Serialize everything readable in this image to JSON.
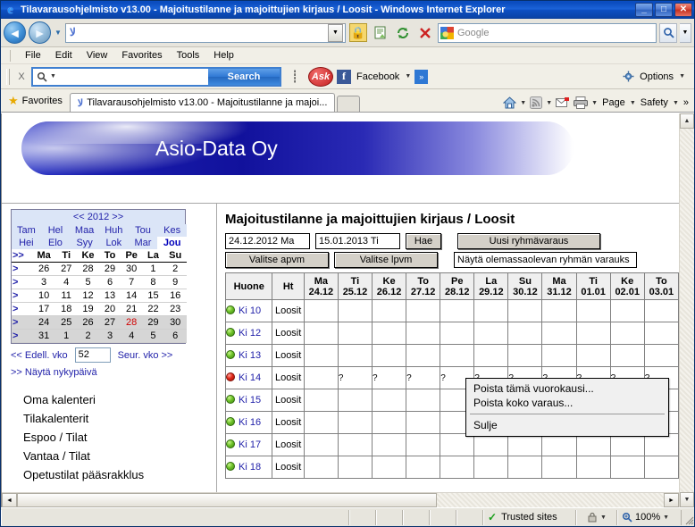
{
  "window": {
    "title": "Tilavarausohjelmisto v13.00 - Majoitustilanne ja majoittujien kirjaus / Loosit - Windows Internet Explorer",
    "minimize": "_",
    "maximize": "□",
    "close": "✕"
  },
  "addressbar": {
    "url": "",
    "back_icon": "◄",
    "forward_icon": "►",
    "dropdown_icon": "▼",
    "google_placeholder": "Google"
  },
  "menubar": {
    "items": [
      "File",
      "Edit",
      "View",
      "Favorites",
      "Tools",
      "Help"
    ]
  },
  "asktoolbar": {
    "close_label": "X",
    "search_value": "",
    "search_button": "Search",
    "ask_logo": "Ask",
    "facebook_label": "Facebook",
    "more_chevron": "»",
    "options_label": "Options"
  },
  "tabbar": {
    "favorites_label": "Favorites",
    "tab_title": "Tilavarausohjelmisto v13.00 - Majoitustilanne ja majoi...",
    "page_label": "Page",
    "safety_label": "Safety",
    "overflow": "»"
  },
  "banner": {
    "company": "Asio-Data Oy"
  },
  "calendar": {
    "year_nav": "<< 2012 >>",
    "months_row1": [
      "Tam",
      "Hel",
      "Maa",
      "Huh",
      "Tou",
      "Kes"
    ],
    "months_row2": [
      "Hei",
      "Elo",
      "Syy",
      "Lok",
      "Mar",
      "Jou"
    ],
    "current_month": "Jou",
    "header_arrow": ">>",
    "weekdays": [
      "Ma",
      "Ti",
      "Ke",
      "To",
      "Pe",
      "La",
      "Su"
    ],
    "row_arrow": ">",
    "weeks": [
      {
        "days": [
          "26",
          "27",
          "28",
          "29",
          "30",
          "1",
          "2"
        ],
        "selected": false
      },
      {
        "days": [
          "3",
          "4",
          "5",
          "6",
          "7",
          "8",
          "9"
        ],
        "selected": false
      },
      {
        "days": [
          "10",
          "11",
          "12",
          "13",
          "14",
          "15",
          "16"
        ],
        "selected": false
      },
      {
        "days": [
          "17",
          "18",
          "19",
          "20",
          "21",
          "22",
          "23"
        ],
        "selected": false
      },
      {
        "days": [
          "24",
          "25",
          "26",
          "27",
          "28",
          "29",
          "30"
        ],
        "selected": true,
        "today_index": 4
      },
      {
        "days": [
          "31",
          "1",
          "2",
          "3",
          "4",
          "5",
          "6"
        ],
        "selected": true
      }
    ],
    "prev_week": "<< Edell. vko",
    "week_number": "52",
    "next_week": "Seur. vko >>",
    "today_link": ">> Näytä nykypäivä"
  },
  "sidebar": {
    "items": [
      {
        "label": "Oma kalenteri"
      },
      {
        "label": "Tilakalenterit"
      },
      {
        "label": "Espoo / Tilat"
      },
      {
        "label": "Vantaa / Tilat"
      },
      {
        "label": "Opetustilat pääsrakklus"
      }
    ]
  },
  "main": {
    "page_title": "Majoitustilanne ja majoittujien kirjaus / Loosit",
    "start_date": "24.12.2012 Ma",
    "end_date": "15.01.2013 Ti",
    "search_button": "Hae",
    "new_group_button": "Uusi ryhmävaraus",
    "pick_start_button": "Valitse apvm",
    "pick_end_button": "Valitse lpvm",
    "group_field": "Näytä olemassaolevan ryhmän varauks"
  },
  "booking_table": {
    "col_room": "Huone",
    "col_type": "Ht",
    "day_columns": [
      {
        "dow": "Ma",
        "date": "24.12"
      },
      {
        "dow": "Ti",
        "date": "25.12"
      },
      {
        "dow": "Ke",
        "date": "26.12"
      },
      {
        "dow": "To",
        "date": "27.12"
      },
      {
        "dow": "Pe",
        "date": "28.12"
      },
      {
        "dow": "La",
        "date": "29.12"
      },
      {
        "dow": "Su",
        "date": "30.12"
      },
      {
        "dow": "Ma",
        "date": "31.12"
      },
      {
        "dow": "Ti",
        "date": "01.01"
      },
      {
        "dow": "Ke",
        "date": "02.01"
      },
      {
        "dow": "To",
        "date": "03.01"
      }
    ],
    "booked_marker": "?",
    "rows": [
      {
        "room": "Ki 10",
        "type": "Loosit",
        "status": "free",
        "cells": [
          0,
          0,
          0,
          0,
          0,
          0,
          0,
          0,
          0,
          0,
          0
        ]
      },
      {
        "room": "Ki 12",
        "type": "Loosit",
        "status": "free",
        "cells": [
          0,
          0,
          0,
          0,
          0,
          0,
          0,
          0,
          0,
          0,
          0
        ]
      },
      {
        "room": "Ki 13",
        "type": "Loosit",
        "status": "free",
        "cells": [
          0,
          0,
          0,
          0,
          0,
          0,
          0,
          0,
          0,
          0,
          0
        ]
      },
      {
        "room": "Ki 14",
        "type": "Loosit",
        "status": "occupied",
        "cells": [
          0,
          1,
          1,
          1,
          1,
          1,
          1,
          1,
          1,
          1,
          1
        ]
      },
      {
        "room": "Ki 15",
        "type": "Loosit",
        "status": "free",
        "cells": [
          0,
          0,
          0,
          0,
          0,
          0,
          0,
          0,
          0,
          0,
          0
        ]
      },
      {
        "room": "Ki 16",
        "type": "Loosit",
        "status": "free",
        "cells": [
          0,
          0,
          0,
          0,
          0,
          0,
          0,
          0,
          0,
          0,
          0
        ]
      },
      {
        "room": "Ki 17",
        "type": "Loosit",
        "status": "free",
        "cells": [
          0,
          0,
          0,
          0,
          0,
          0,
          0,
          0,
          0,
          0,
          0
        ]
      },
      {
        "room": "Ki 18",
        "type": "Loosit",
        "status": "free",
        "cells": [
          0,
          0,
          0,
          0,
          0,
          0,
          0,
          0,
          0,
          0,
          0
        ]
      }
    ]
  },
  "context_menu": {
    "items": [
      "Poista tämä vuorokausi...",
      "Poista koko varaus..."
    ],
    "close_item": "Sulje"
  },
  "statusbar": {
    "message": "",
    "zone": "Trusted sites",
    "zoom": "100%",
    "dropdown_icon": "▼"
  },
  "colors": {
    "booked": "#f5c400",
    "free_dot": "#6fc22a",
    "occupied_dot": "#e02818",
    "link": "#2222aa",
    "banner": "#11119c"
  }
}
